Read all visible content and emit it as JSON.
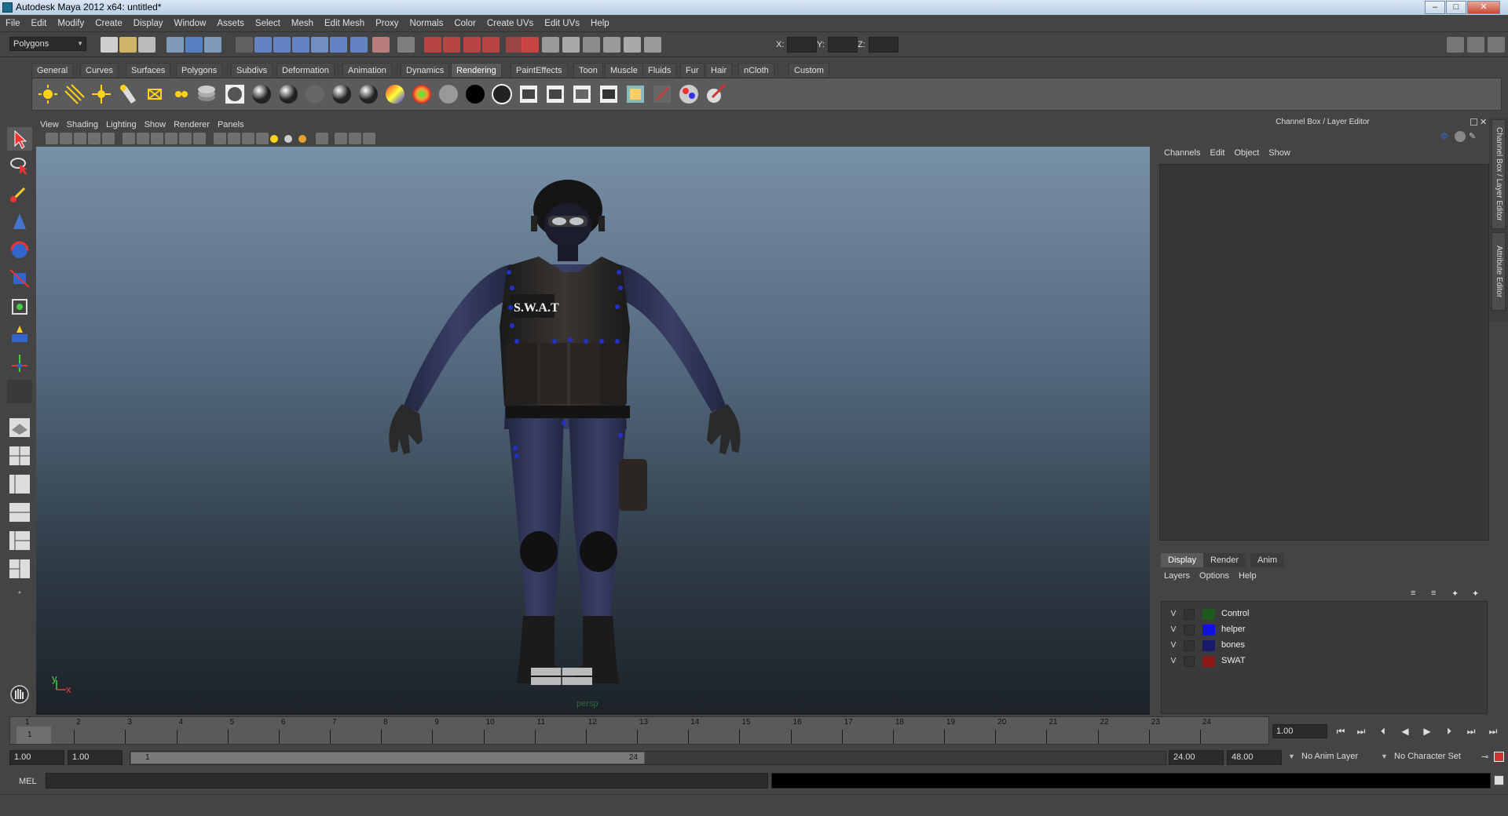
{
  "window": {
    "title": "Autodesk Maya 2012 x64: untitled*",
    "minimize": "–",
    "maximize": "□",
    "close": "✕"
  },
  "menubar": [
    "File",
    "Edit",
    "Modify",
    "Create",
    "Display",
    "Window",
    "Assets",
    "Select",
    "Mesh",
    "Edit Mesh",
    "Proxy",
    "Normals",
    "Color",
    "Create UVs",
    "Edit UVs",
    "Help"
  ],
  "statusline": {
    "mode": "Polygons",
    "x_label": "X:",
    "y_label": "Y:",
    "z_label": "Z:"
  },
  "shelf": {
    "tabs": [
      "General",
      "Curves",
      "Surfaces",
      "Polygons",
      "Subdivs",
      "Deformation",
      "Animation",
      "Dynamics",
      "Rendering",
      "PaintEffects",
      "Toon",
      "Muscle",
      "Fluids",
      "Fur",
      "Hair",
      "nCloth",
      "Custom"
    ],
    "active_tab": "Rendering"
  },
  "viewport": {
    "menu": [
      "View",
      "Shading",
      "Lighting",
      "Show",
      "Renderer",
      "Panels"
    ],
    "camera_label": "persp",
    "axis_y": "y",
    "axis_x": "x",
    "model": {
      "vest_text": "S.W.A.T"
    }
  },
  "channel_box": {
    "title": "Channel Box / Layer Editor",
    "menu": [
      "Channels",
      "Edit",
      "Object",
      "Show"
    ]
  },
  "side_tabs": [
    "Channel Box / Layer Editor",
    "Attribute Editor"
  ],
  "layer_editor": {
    "tabs": [
      "Display",
      "Render",
      "Anim"
    ],
    "active_tab": "Display",
    "menu": [
      "Layers",
      "Options",
      "Help"
    ],
    "layers": [
      {
        "visible": "V",
        "name": "Control",
        "color": "#1e5a1e"
      },
      {
        "visible": "V",
        "name": "helper",
        "color": "#1010e0"
      },
      {
        "visible": "V",
        "name": "bones",
        "color": "#1a1a6a"
      },
      {
        "visible": "V",
        "name": "SWAT",
        "color": "#8a1a1a"
      }
    ]
  },
  "timeline": {
    "frames": [
      "1",
      "2",
      "3",
      "4",
      "5",
      "6",
      "7",
      "8",
      "9",
      "10",
      "11",
      "12",
      "13",
      "14",
      "15",
      "16",
      "17",
      "18",
      "19",
      "20",
      "21",
      "22",
      "23",
      "24"
    ],
    "current_frame_marker": "1",
    "current_time": "1.00"
  },
  "playback": {
    "go_start": "⏮",
    "step_back_key": "⏭",
    "step_back": "⏴",
    "play_back": "◀",
    "play_fwd": "▶",
    "step_fwd": "⏵",
    "step_fwd_key": "⏭",
    "go_end": "⏭"
  },
  "range": {
    "start_time": "1.00",
    "playback_start": "1.00",
    "slider_start": "1",
    "slider_end": "24",
    "playback_end": "24.00",
    "end_time": "48.00",
    "anim_layer": "No Anim Layer",
    "character_set": "No Character Set"
  },
  "cmdline": {
    "label": "MEL"
  }
}
